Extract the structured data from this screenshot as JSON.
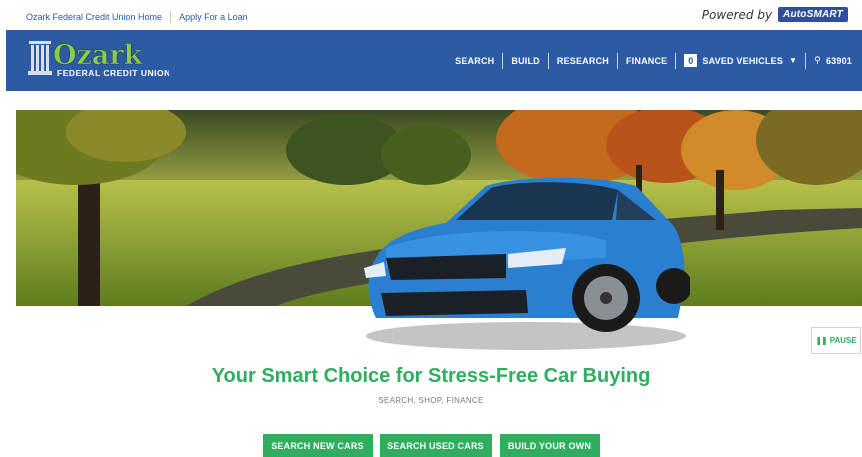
{
  "top_links": [
    "Ozark Federal Credit Union Home",
    "Apply For a Loan"
  ],
  "powered": {
    "text": "Powered by",
    "brand": "AutoSMART"
  },
  "logo": {
    "name": "Ozark",
    "sub": "FEDERAL CREDIT UNION"
  },
  "nav": {
    "search": "SEARCH",
    "build": "BUILD",
    "research": "RESEARCH",
    "finance": "FINANCE",
    "saved_count": "0",
    "saved_label": "SAVED VEHICLES",
    "zip": "63901"
  },
  "hero": {
    "pause": "PAUSE"
  },
  "headline": "Your Smart Choice for Stress-Free Car Buying",
  "subline": "SEARCH, SHOP, FINANCE",
  "ctas": [
    "SEARCH NEW CARS",
    "SEARCH USED CARS",
    "BUILD YOUR OWN"
  ],
  "colors": {
    "nav": "#2d5ba3",
    "accent_green": "#2eae5e",
    "link_blue": "#2a5aa0"
  }
}
